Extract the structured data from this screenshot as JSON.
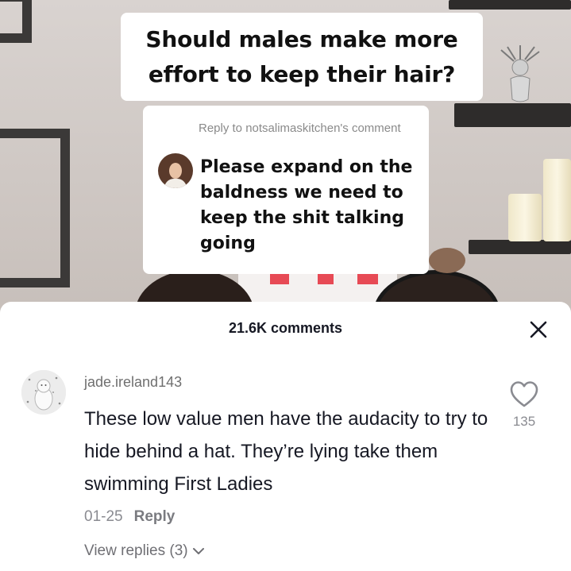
{
  "video": {
    "title": "Should males make more effort to keep their hair?",
    "reply_card": {
      "reply_to": "Reply to notsalimaskitchen's comment",
      "text": "Please expand on the baldness we need to keep the shit talking going"
    }
  },
  "comments_panel": {
    "count_label": "21.6K comments",
    "close_icon": "close-icon",
    "comment": {
      "username": "jade.ireland143",
      "text": "These low value men have the audacity to try to hide behind a hat. They’re lying take them swimming First Ladies",
      "date": "01-25",
      "reply_label": "Reply",
      "like_count": "135",
      "like_icon": "heart-outline-icon",
      "view_replies_label": "View replies (3)",
      "view_replies_icon": "chevron-down-icon"
    }
  },
  "colors": {
    "sheet_background": "#ffffff",
    "primary_text": "#161823",
    "secondary_text": "#8a8b91"
  }
}
